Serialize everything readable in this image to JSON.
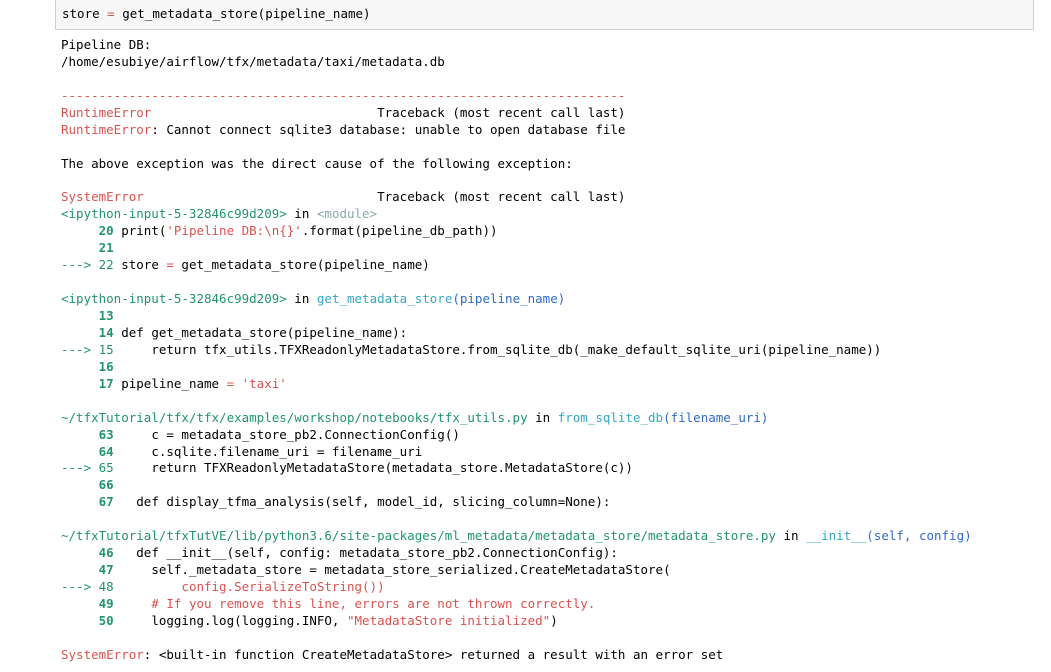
{
  "input_cell": {
    "var": "store",
    "op": " = ",
    "rest": "get_metadata_store(pipeline_name)"
  },
  "output": {
    "db_label": "Pipeline DB:",
    "db_path": "/home/esubiye/airflow/tfx/metadata/taxi/metadata.db",
    "separator": "---------------------------------------------------------------------------",
    "err1_name": "RuntimeError",
    "traceback_hdr": "Traceback (most recent call last)",
    "err1_msg": ": Cannot connect sqlite3 database: unable to open database file",
    "cause_msg": "The above exception was the direct cause of the following exception:",
    "err2_name": "SystemError",
    "frame1": {
      "file": "<ipython-input-5-32846c99d209>",
      "in": " in ",
      "func": "<module>",
      "l20_num": "     20 ",
      "l20_a": "print(",
      "l20_str": "'Pipeline DB:\\n{}'",
      "l20_b": ".format(pipeline_db_path))",
      "l21_num": "     21 ",
      "l22_arrow": "---> 22 ",
      "l22_a": "store ",
      "l22_op": "=",
      "l22_b": " get_metadata_store(pipeline_name)"
    },
    "frame2": {
      "file": "<ipython-input-5-32846c99d209>",
      "in": " in ",
      "func": "get_metadata_store",
      "args": "(pipeline_name)",
      "l13_num": "     13 ",
      "l14_num": "     14 ",
      "l14_code": "def get_metadata_store(pipeline_name):",
      "l15_arrow": "---> 15 ",
      "l15_a": "    return tfx_utils.TFXReadonlyMetadataStore.from_sqlite_db(_make_default_sqlite_uri(pipeline_name))",
      "l16_num": "     16 ",
      "l17_num": "     17 ",
      "l17_a": "pipeline_name ",
      "l17_op": "=",
      "l17_str": " 'taxi'"
    },
    "frame3": {
      "file": "~/tfxTutorial/tfx/tfx/examples/workshop/notebooks/tfx_utils.py",
      "in": " in ",
      "func": "from_sqlite_db",
      "args": "(filename_uri)",
      "l63_num": "     63 ",
      "l63_code": "    c = metadata_store_pb2.ConnectionConfig()",
      "l64_num": "     64 ",
      "l64_code": "    c.sqlite.filename_uri = filename_uri",
      "l65_arrow": "---> 65 ",
      "l65_code": "    return TFXReadonlyMetadataStore(metadata_store.MetadataStore(c))",
      "l66_num": "     66 ",
      "l67_num": "     67 ",
      "l67_code": "  def display_tfma_analysis(self, model_id, slicing_column=None):"
    },
    "frame4": {
      "file": "~/tfxTutorial/tfxTutVE/lib/python3.6/site-packages/ml_metadata/metadata_store/metadata_store.py",
      "in": " in ",
      "func": "__init__",
      "args": "(self, config)",
      "l46_num": "     46 ",
      "l46_code": "  def __init__(self, config: metadata_store_pb2.ConnectionConfig):",
      "l47_num": "     47 ",
      "l47_code": "    self._metadata_store = metadata_store_serialized.CreateMetadataStore(",
      "l48_arrow": "---> 48 ",
      "l48_code": "        config.SerializeToString())",
      "l49_num": "     49 ",
      "l49_code": "    # If you remove this line, errors are not thrown correctly.",
      "l50_num": "     50 ",
      "l50_a": "    logging.log(logging.INFO, ",
      "l50_str": "\"MetadataStore initialized\"",
      "l50_b": ")"
    },
    "final_err_name": "SystemError",
    "final_err_msg": ": <built-in function CreateMetadataStore> returned a result with an error set"
  }
}
